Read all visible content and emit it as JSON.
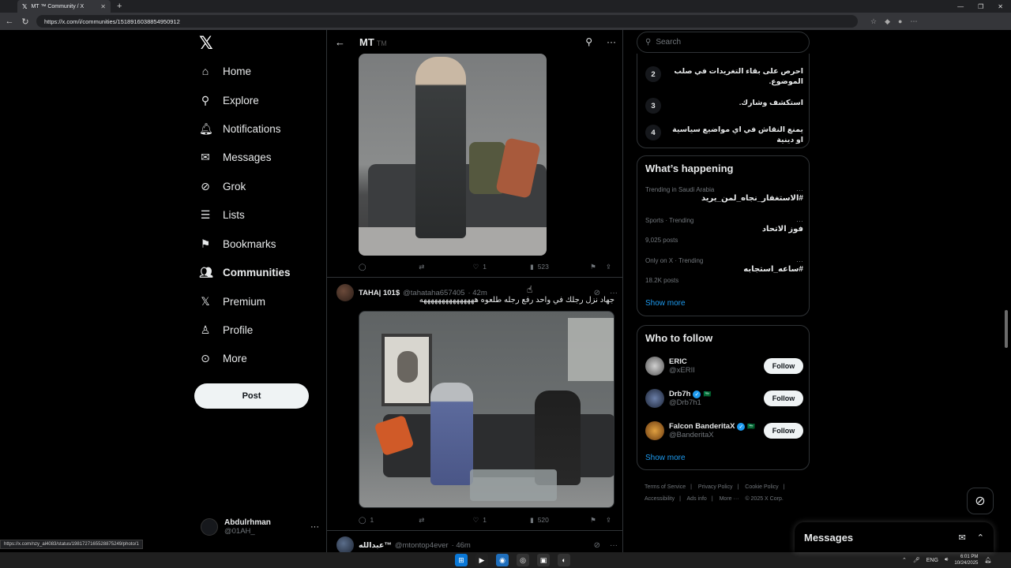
{
  "browser": {
    "tab_title": "MT ™ Community / X",
    "url": "https://x.com/i/communities/1518916038854950912",
    "status_url": "https://x.com/nzy_al4083/status/1981727165528875249/photo/1"
  },
  "nav": {
    "logo": "𝕏",
    "items": [
      {
        "label": "Home",
        "icon": "home-icon"
      },
      {
        "label": "Explore",
        "icon": "search-icon"
      },
      {
        "label": "Notifications",
        "icon": "bell-icon"
      },
      {
        "label": "Messages",
        "icon": "envelope-icon"
      },
      {
        "label": "Grok",
        "icon": "grok-icon"
      },
      {
        "label": "Lists",
        "icon": "list-icon"
      },
      {
        "label": "Bookmarks",
        "icon": "bookmark-icon"
      },
      {
        "label": "Communities",
        "icon": "communities-icon"
      },
      {
        "label": "Premium",
        "icon": "x-premium-icon"
      },
      {
        "label": "Profile",
        "icon": "person-icon"
      },
      {
        "label": "More",
        "icon": "more-circle-icon"
      }
    ],
    "post_label": "Post",
    "account_name": "Abdulrhman",
    "account_handle": "@01AH_"
  },
  "community": {
    "title": "MT",
    "title_suffix": "TM"
  },
  "tweets": [
    {
      "replies": "",
      "retweets": "",
      "likes": "1",
      "views": "523"
    },
    {
      "name": "TAHA| 101$",
      "handle": "@tahataha657405",
      "time": "· 42m",
      "text": "جهاد نزل رجلك في واحد رفع رجله  طلعوه هههههههههههههههه",
      "replies": "1",
      "retweets": "",
      "likes": "1",
      "views": "520"
    },
    {
      "name": "عبدالله™",
      "handle": "@mtontop4ever",
      "time": "· 46m"
    }
  ],
  "right": {
    "search_placeholder": "Search",
    "rules": [
      {
        "num": "2",
        "text": "احرص على بقاء التغريدات في صلب الموضوع."
      },
      {
        "num": "3",
        "text": "استكشف وشارك."
      },
      {
        "num": "4",
        "text": "يمنع النقاش في اي مواضيع سياسية او دينية"
      }
    ],
    "happening_title": "What’s happening",
    "trends": [
      {
        "context": "Trending in Saudi Arabia",
        "name": "#الاستغفار_نجاه_لمن_يريد",
        "posts": ""
      },
      {
        "context": "Sports · Trending",
        "name": "فوز الاتحاد",
        "posts": "9,025 posts"
      },
      {
        "context": "Only on X · Trending",
        "name": "#ساعه_استجابه",
        "posts": "18.2K posts"
      }
    ],
    "show_more": "Show more",
    "who_title": "Who to follow",
    "follows": [
      {
        "name": "ERIC",
        "handle": "@xERII",
        "verified": false,
        "flag": ""
      },
      {
        "name": "Drb7h",
        "handle": "@Drb7h1",
        "verified": true,
        "flag": "🇸🇦"
      },
      {
        "name": "Falcon BanderitaX",
        "handle": "@BanderitaX",
        "verified": true,
        "flag": "🇸🇦"
      }
    ],
    "follow_label": "Follow",
    "footer": [
      "Terms of Service",
      "|",
      "Privacy Policy",
      "|",
      "Cookie Policy",
      "|",
      "Accessibility",
      "|",
      "Ads info",
      "|",
      "More ···",
      "© 2025 X Corp."
    ]
  },
  "messages_dock": {
    "title": "Messages"
  },
  "taskbar": {
    "lang": "ENG",
    "time": "6:01 PM",
    "date": "10/24/2025"
  },
  "colors": {
    "accent": "#1d9bf0",
    "background": "#000000",
    "border": "#2f3336"
  }
}
